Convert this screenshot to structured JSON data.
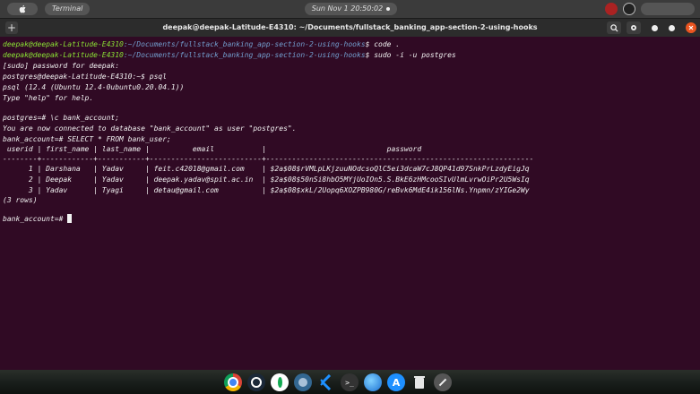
{
  "topbar": {
    "app_name": "Terminal",
    "clock": "Sun Nov 1  20:50:02"
  },
  "window": {
    "title": "deepak@deepak-Latitude-E4310: ~/Documents/fullstack_banking_app-section-2-using-hooks"
  },
  "terminal": {
    "l1": {
      "user": "deepak@deepak-Latitude-E4310",
      "path": ":~/Documents/fullstack_banking_app-section-2-using-hooks",
      "cmd": "$ code ."
    },
    "l2": {
      "user": "deepak@deepak-Latitude-E4310",
      "path": ":~/Documents/fullstack_banking_app-section-2-using-hooks",
      "cmd": "$ sudo -i -u postgres"
    },
    "l3": "[sudo] password for deepak:",
    "l4": "postgres@deepak-Latitude-E4310:~$ psql",
    "l5": "psql (12.4 (Ubuntu 12.4-0ubuntu0.20.04.1))",
    "l6": "Type \"help\" for help.",
    "l7": "postgres=# \\c bank_account;",
    "l8": "You are now connected to database \"bank_account\" as user \"postgres\".",
    "l9": "bank_account=# SELECT * FROM bank_user;",
    "header": " userid | first_name | last_name |          email           |                            password",
    "sep": "--------+------------+-----------+--------------------------+--------------------------------------------------------------",
    "r1": "      1 | Darshana   | Yadav     | feit.c42018@gmail.com    | $2a$08$rVMLpLKjzuuNOdcsoQlC5ei3dcaW7cJ8QP41d97SnkPrLzdyEigJq",
    "r2": "      2 | Deepak     | Yadav     | deepak.yadav@spit.ac.in  | $2a$08$50nSi8hbO5MYjUoIOn5.S.BkE6zHMcooSIvUlmLvrwOiPr2U5WsIq",
    "r3": "      3 | Yadav      | Tyagi     | detau@gmail.com          | $2a$08$xkL/2Uopq6XOZPB980G/reBvk6MdE4ik156lNs.Ynpmn/zYIGe2Wy",
    "rows": "(3 rows)",
    "prompt": "bank_account=# "
  },
  "dock": {
    "icons": [
      "chrome-icon",
      "steam-icon",
      "mongodb-icon",
      "postgres-icon",
      "vscode-icon",
      "terminal-icon",
      "browser-icon",
      "appstore-icon",
      "trash-icon",
      "settings-icon"
    ]
  },
  "colors": {
    "terminal_bg": "#300a24",
    "prompt_user": "#8ae234",
    "prompt_path": "#729fcf"
  }
}
